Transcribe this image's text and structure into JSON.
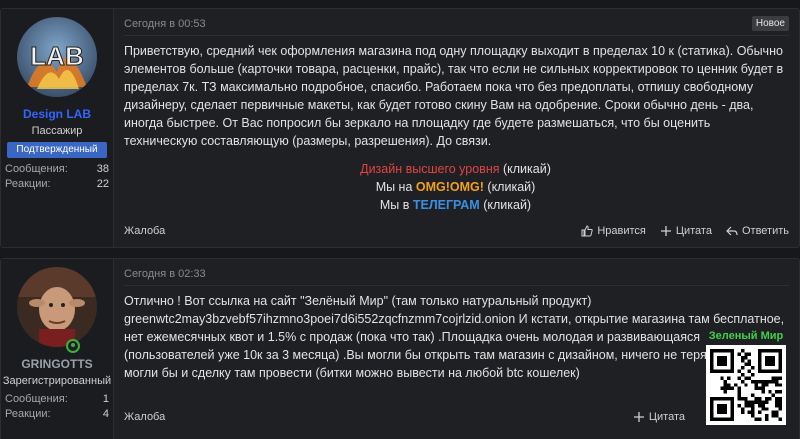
{
  "posts": [
    {
      "user": {
        "name": "Design LAB",
        "name_color": "#3366ff",
        "title": "Пассажир",
        "badge": "Подтвержденный",
        "stats": [
          {
            "label": "Сообщения:",
            "value": "38"
          },
          {
            "label": "Реакции:",
            "value": "22"
          }
        ],
        "avatar_icon": "lab-logo-avatar"
      },
      "date": "Сегодня в 00:53",
      "new_badge": "Новое",
      "body": "Приветствую, средний чек оформления магазина под одну площадку выходит в пределах 10 к (статика). Обычно элементов больше (карточки товара, расценки, прайс), так что если не сильных корректировок то ценник будет в пределах 7к. ТЗ максимально подробное, спасибо. Работаем пока что без предоплаты, отпишу свободному дизайнеру, сделает первичные макеты, как будет готово скину Вам на одобрение. Сроки обычно день - два, иногда быстрее. От Вас попросил бы зеркало на площадку где будете размешаться, что бы оценить техническую составляющую (размеры, разрешения). До связи.",
      "promo": {
        "line1_link": "Дизайн высшего уровня",
        "line1_suffix": " (кликай)",
        "line2_prefix": "Мы на ",
        "line2_link": "OMG!OMG!",
        "line2_suffix": " (кликай)",
        "line3_prefix": "Мы в ",
        "line3_link": "ТЕЛЕГРАМ",
        "line3_suffix": " (кликай)"
      },
      "actions": {
        "report": "Жалоба",
        "like": "Нравится",
        "quote": "Цитата",
        "reply": "Ответить"
      }
    },
    {
      "user": {
        "name": "GRINGOTTS",
        "name_color": "#9aa0a8",
        "title": "Зарегистрированный",
        "stats": [
          {
            "label": "Сообщения:",
            "value": "1"
          },
          {
            "label": "Реакции:",
            "value": "4"
          }
        ],
        "avatar_icon": "goblin-avatar"
      },
      "date": "Сегодня в 02:33",
      "body": "Отлично ! Вот ссылка на сайт \"Зелёный Мир\" (там только натуральный продукт) greenwtc2may3bzvebf57ihzmno3poei7d6i552zqcfnzmm7cojrlzid.onion И кстати, открытие магазина там бесплатное, нет ежемесячных квот и 1.5% с продаж (пока что так) .Площадка очень молодая и развивающаяся (пользователей уже 10к за 3 месяца) .Вы могли бы открыть там магазин с дизайном, ничего не теряете. Мы могли бы и сделку там провести (битки можно вывести на любой btc кошелек)",
      "actions": {
        "report": "Жалоба",
        "quote": "Цитата"
      }
    }
  ],
  "qr": {
    "label": "Зеленый Мир",
    "icon": "qr-code-icon"
  }
}
